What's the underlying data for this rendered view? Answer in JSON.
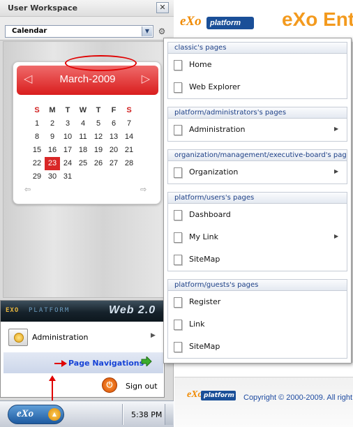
{
  "workspace": {
    "title": "User Workspace",
    "close_icon": "close-icon",
    "close_glyph": "✕",
    "selected_app": "Calendar"
  },
  "calendar": {
    "month_label": "March-2009",
    "weekday_headers": [
      "S",
      "M",
      "T",
      "W",
      "T",
      "F",
      "S"
    ],
    "weeks": [
      [
        "1",
        "2",
        "3",
        "4",
        "5",
        "6",
        "7"
      ],
      [
        "8",
        "9",
        "10",
        "11",
        "12",
        "13",
        "14"
      ],
      [
        "15",
        "16",
        "17",
        "18",
        "19",
        "20",
        "21"
      ],
      [
        "22",
        "23",
        "24",
        "25",
        "26",
        "27",
        "28"
      ],
      [
        "29",
        "30",
        "31",
        "",
        "",
        "",
        ""
      ]
    ],
    "today": "23",
    "accent_color": "#d92727"
  },
  "start_menu": {
    "brand": "EXO",
    "brand_suffix": "PLATFORM",
    "tagline": "Web 2.0",
    "items": [
      {
        "label": "Administration",
        "icon": "admin-gear-icon",
        "has_submenu": true
      }
    ],
    "page_navigations_label": "Page Navigations",
    "signout_label": "Sign out"
  },
  "taskbar": {
    "start_button_label": "eXo",
    "clock": "5:38 PM"
  },
  "page": {
    "logo_text": "eXo",
    "logo_platform_text": "platform",
    "banner_text": "eXo Ent",
    "copyright": "Copyright © 2000-2009. All right"
  },
  "navigation_groups": [
    {
      "title": "classic's pages",
      "pages": [
        {
          "label": "Home",
          "has_submenu": false
        },
        {
          "label": "Web Explorer",
          "has_submenu": false
        }
      ]
    },
    {
      "title": "platform/administrators's pages",
      "pages": [
        {
          "label": "Administration",
          "has_submenu": true
        }
      ]
    },
    {
      "title": "organization/management/executive-board's pages",
      "pages": [
        {
          "label": "Organization",
          "has_submenu": true
        }
      ]
    },
    {
      "title": "platform/users's pages",
      "pages": [
        {
          "label": "Dashboard",
          "has_submenu": false
        },
        {
          "label": "My Link",
          "has_submenu": true
        },
        {
          "label": "SiteMap",
          "has_submenu": false
        }
      ]
    },
    {
      "title": "platform/guests's pages",
      "pages": [
        {
          "label": "Register",
          "has_submenu": false
        },
        {
          "label": "Link",
          "has_submenu": false
        },
        {
          "label": "SiteMap",
          "has_submenu": false
        }
      ]
    }
  ]
}
